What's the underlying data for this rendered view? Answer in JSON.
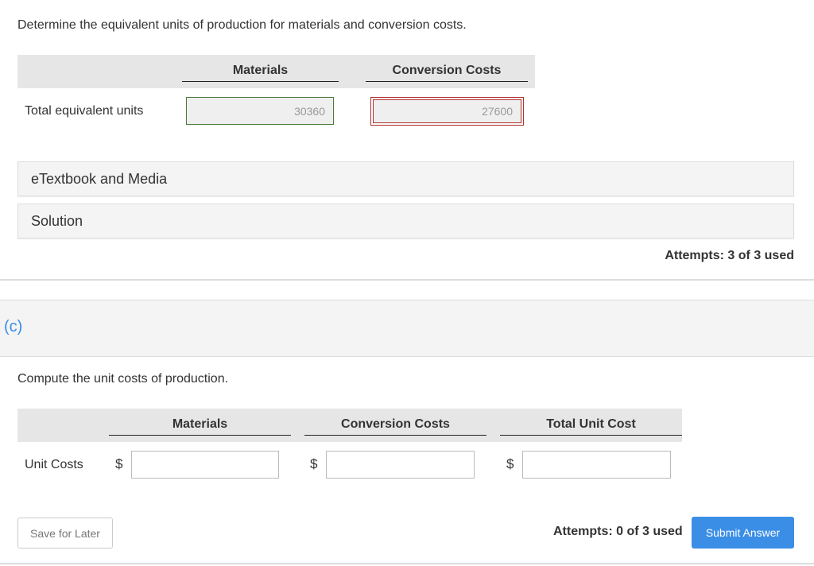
{
  "part_b": {
    "prompt": "Determine the equivalent units of production for materials and conversion costs.",
    "columns": [
      "Materials",
      "Conversion Costs"
    ],
    "row_label": "Total equivalent units",
    "values": {
      "materials": "30360",
      "conversion": "27600"
    },
    "status": {
      "materials": "correct",
      "conversion": "incorrect"
    },
    "panels": [
      "eTextbook and Media",
      "Solution"
    ],
    "attempts": "Attempts: 3 of 3 used"
  },
  "part_c": {
    "label": "(c)",
    "prompt": "Compute the unit costs of production.",
    "columns": [
      "Materials",
      "Conversion Costs",
      "Total Unit Cost"
    ],
    "row_label": "Unit Costs",
    "currency": "$",
    "values": {
      "materials": "",
      "conversion": "",
      "total": ""
    },
    "save_label": "Save for Later",
    "attempts": "Attempts: 0 of 3 used",
    "submit_label": "Submit Answer"
  },
  "colors": {
    "accent": "#3a8ee6",
    "correct_border": "#4a7a3a",
    "incorrect_border": "#b03030"
  }
}
